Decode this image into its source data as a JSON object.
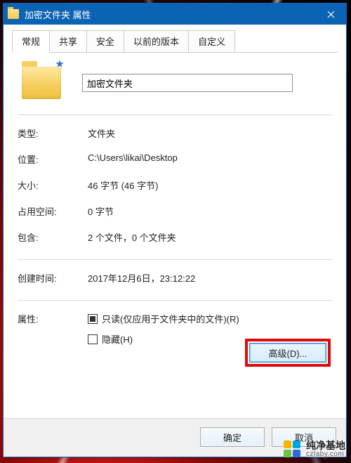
{
  "titlebar": {
    "title": "加密文件夹 属性"
  },
  "tabs": {
    "general": "常规",
    "share": "共享",
    "security": "安全",
    "previous": "以前的版本",
    "custom": "自定义"
  },
  "folder": {
    "name": "加密文件夹"
  },
  "labels": {
    "type": "类型:",
    "location": "位置:",
    "size": "大小:",
    "size_on_disk": "占用空间:",
    "contains": "包含:",
    "created": "创建时间:",
    "attributes": "属性:"
  },
  "values": {
    "type": "文件夹",
    "location": "C:\\Users\\likai\\Desktop",
    "size": "46 字节 (46 字节)",
    "size_on_disk": "0 字节",
    "contains": "2 个文件，0 个文件夹",
    "created": "2017年12月6日，23:12:22"
  },
  "attributes": {
    "readonly": "只读(仅应用于文件夹中的文件)(R)",
    "hidden": "隐藏(H)",
    "advanced": "高级(D)..."
  },
  "buttons": {
    "ok": "确定",
    "cancel": "取消"
  },
  "watermark": {
    "name": "纯净基地",
    "url": "czlaby.com"
  }
}
